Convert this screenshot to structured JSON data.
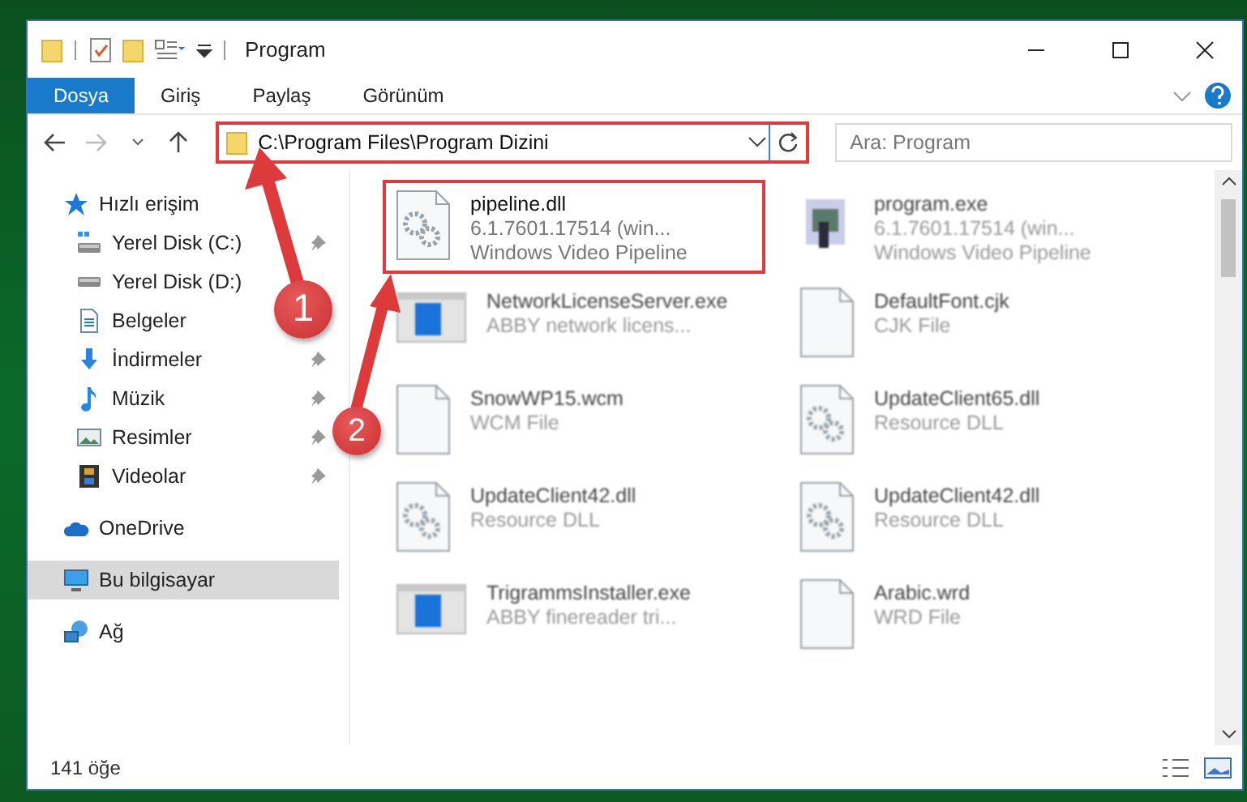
{
  "window": {
    "title": "Program"
  },
  "ribbon": {
    "tabs": [
      {
        "label": "Dosya",
        "selected": true
      },
      {
        "label": "Giriş",
        "selected": false
      },
      {
        "label": "Paylaş",
        "selected": false
      },
      {
        "label": "Görünüm",
        "selected": false
      }
    ]
  },
  "address_bar": {
    "path": "C:\\Program Files\\Program Dizini",
    "highlighted": true
  },
  "search": {
    "placeholder": "Ara: Program"
  },
  "sidebar": {
    "groups": [
      {
        "label": "Hızlı erişim",
        "kind": "star",
        "selected": false,
        "children": [
          {
            "label": "Yerel Disk (C:)",
            "kind": "drive-c",
            "pinned": true
          },
          {
            "label": "Yerel Disk (D:)",
            "kind": "drive",
            "pinned": false
          },
          {
            "label": "Belgeler",
            "kind": "document",
            "pinned": false
          },
          {
            "label": "İndirmeler",
            "kind": "download",
            "pinned": true
          },
          {
            "label": "Müzik",
            "kind": "music",
            "pinned": true
          },
          {
            "label": "Resimler",
            "kind": "image",
            "pinned": true
          },
          {
            "label": "Videolar",
            "kind": "film",
            "pinned": true
          }
        ]
      },
      {
        "label": "OneDrive",
        "kind": "cloud",
        "selected": false
      },
      {
        "label": "Bu bilgisayar",
        "kind": "monitor",
        "selected": true
      },
      {
        "label": "Ağ",
        "kind": "network",
        "selected": false
      }
    ]
  },
  "files": [
    {
      "name": "pipeline.dll",
      "details": [
        "6.1.7601.17514 (win...",
        "Windows Video Pipeline"
      ],
      "kind": "dll",
      "highlighted": true
    },
    {
      "name": "program.exe",
      "details": [
        "6.1.7601.17514 (win...",
        "Windows Video Pipeline"
      ],
      "kind": "app",
      "highlighted": false
    },
    {
      "name": "NetworkLicenseServer.exe",
      "details": [
        "ABBY network licens..."
      ],
      "kind": "window",
      "highlighted": false
    },
    {
      "name": "DefaultFont.cjk",
      "details": [
        "CJK File"
      ],
      "kind": "blank",
      "highlighted": false
    },
    {
      "name": "SnowWP15.wcm",
      "details": [
        "WCM File"
      ],
      "kind": "blank",
      "highlighted": false
    },
    {
      "name": "UpdateClient65.dll",
      "details": [
        "Resource DLL"
      ],
      "kind": "dll",
      "highlighted": false
    },
    {
      "name": "UpdateClient42.dll",
      "details": [
        "Resource DLL"
      ],
      "kind": "dll",
      "highlighted": false
    },
    {
      "name": "UpdateClient42.dll",
      "details": [
        "Resource DLL"
      ],
      "kind": "dll",
      "highlighted": false
    },
    {
      "name": "TrigrammsInstaller.exe",
      "details": [
        "ABBY finereader tri..."
      ],
      "kind": "window",
      "highlighted": false
    },
    {
      "name": "Arabic.wrd",
      "details": [
        "WRD File"
      ],
      "kind": "blank",
      "highlighted": false
    }
  ],
  "status_bar": {
    "count": "141 öğe"
  },
  "annotations": [
    {
      "number": "1"
    },
    {
      "number": "2"
    }
  ]
}
